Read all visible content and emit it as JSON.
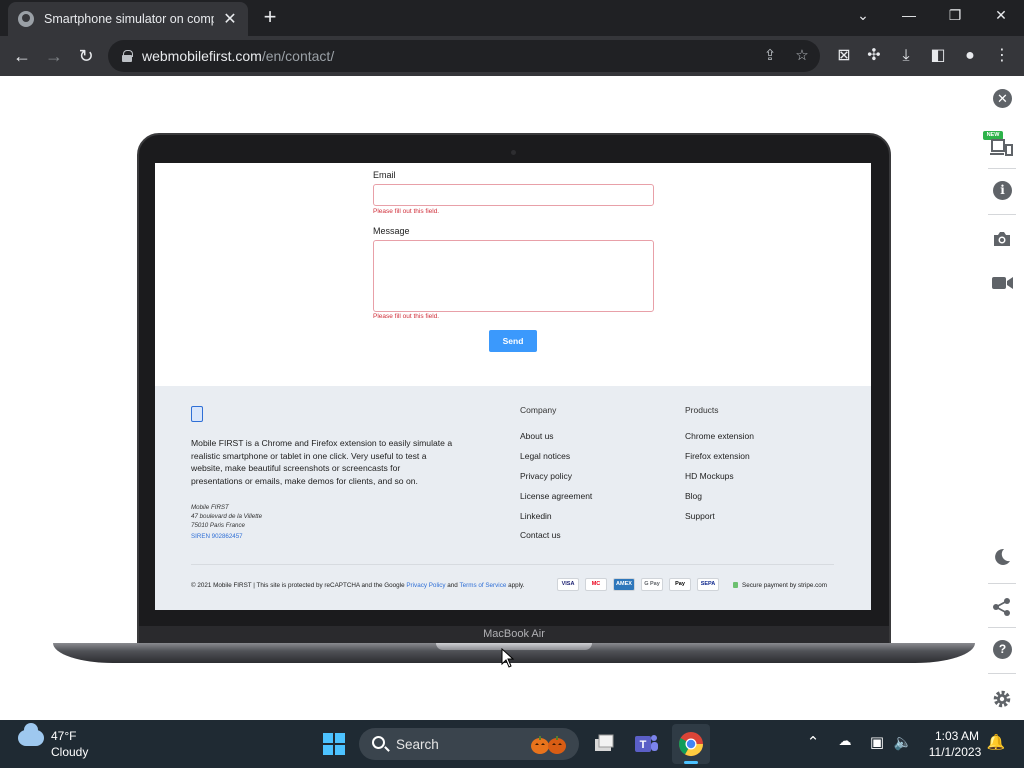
{
  "browser": {
    "tab_title": "Smartphone simulator on comp",
    "tab_close": "✕",
    "new_tab": "+",
    "url_host": "webmobilefirst.com",
    "url_path": "/en/contact/"
  },
  "form": {
    "email_label": "Email",
    "email_error": "Please fill out this field.",
    "message_label": "Message",
    "message_error": "Please fill out this field.",
    "send_label": "Send"
  },
  "footer": {
    "description": "Mobile FIRST is a Chrome and Firefox extension to easily simulate a realistic smartphone or tablet in one click. Very useful to test a website, make beautiful screenshots or screencasts for presentations or emails, make demos for clients, and so on.",
    "address_line1": "Mobile FIRST",
    "address_line2": "47 boulevard de la Villette",
    "address_line3": "75010 Paris France",
    "siren": "SIREN 902862457",
    "company_title": "Company",
    "company_links": [
      "About us",
      "Legal notices",
      "Privacy policy",
      "License agreement",
      "Linkedin",
      "Contact us"
    ],
    "products_title": "Products",
    "products_links": [
      "Chrome extension",
      "Firefox extension",
      "HD Mockups",
      "Blog",
      "Support"
    ],
    "copyright_prefix": "© 2021 Mobile FIRST | This site is protected by reCAPTCHA and the Google ",
    "privacy_policy": "Privacy Policy",
    "and": " and ",
    "terms": "Terms of Service",
    "apply": " apply.",
    "payment_methods": [
      "VISA",
      "MC",
      "AMEX",
      "G Pay",
      "Pay",
      "SEPA"
    ],
    "secure_payment": "Secure payment by stripe.com"
  },
  "device": {
    "label": "MacBook Air"
  },
  "side_panel": {
    "new_badge": "NEW"
  },
  "taskbar": {
    "temperature": "47°F",
    "weather": "Cloudy",
    "search_label": "Search",
    "time": "1:03 AM",
    "date": "11/1/2023"
  },
  "colors": {
    "accent": "#3b99fc",
    "error": "#d0303b",
    "footer_bg": "#e9edf2",
    "taskbar_bg": "#1f2a33"
  }
}
